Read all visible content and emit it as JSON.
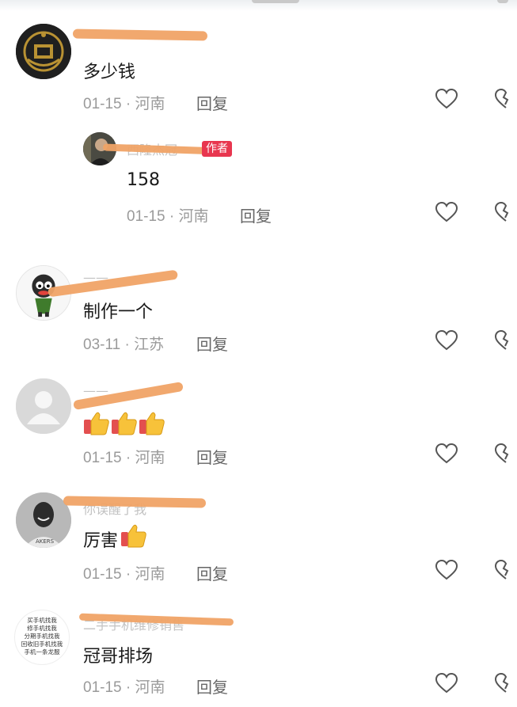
{
  "comments": [
    {
      "content": "多少钱",
      "meta": "01-15 · 河南",
      "reply": "回复",
      "avatar": "gold-emblem-avatar"
    },
    {
      "content": "158",
      "meta": "01-15 · 河南",
      "reply": "回复",
      "author_tag": "作者",
      "obscured_name": "西隆杰冠",
      "avatar": "person-avatar"
    },
    {
      "content": "制作一个",
      "meta": "03-11 · 江苏",
      "reply": "回复",
      "avatar": "cartoon-avatar"
    },
    {
      "content": "",
      "meta": "01-15 · 河南",
      "reply": "回复",
      "avatar": "default-avatar",
      "emoji": [
        "thumbs-up-icon",
        "thumbs-up-icon",
        "thumbs-up-icon"
      ]
    },
    {
      "content": "厉害",
      "meta": "01-15 · 河南",
      "reply": "回复",
      "obscured_name": "你误醒了我",
      "avatar": "player-avatar",
      "emoji": [
        "thumbs-up-icon"
      ]
    },
    {
      "content": "冠哥排场",
      "meta": "01-15 · 河南",
      "reply": "回复",
      "obscured_name": "二手手机维修销售",
      "avatar": "text-avatar",
      "avatar_text": [
        "买手机找我",
        "修手机找我",
        "分期手机找我",
        "回收旧手机找我",
        "手机一条龙服"
      ]
    }
  ],
  "icons": {
    "like": "heart-icon",
    "dislike": "broken-heart-icon"
  },
  "colors": {
    "scribble": "#f0a366",
    "author_tag": "#e8364f",
    "meta": "#9a9a9a"
  }
}
